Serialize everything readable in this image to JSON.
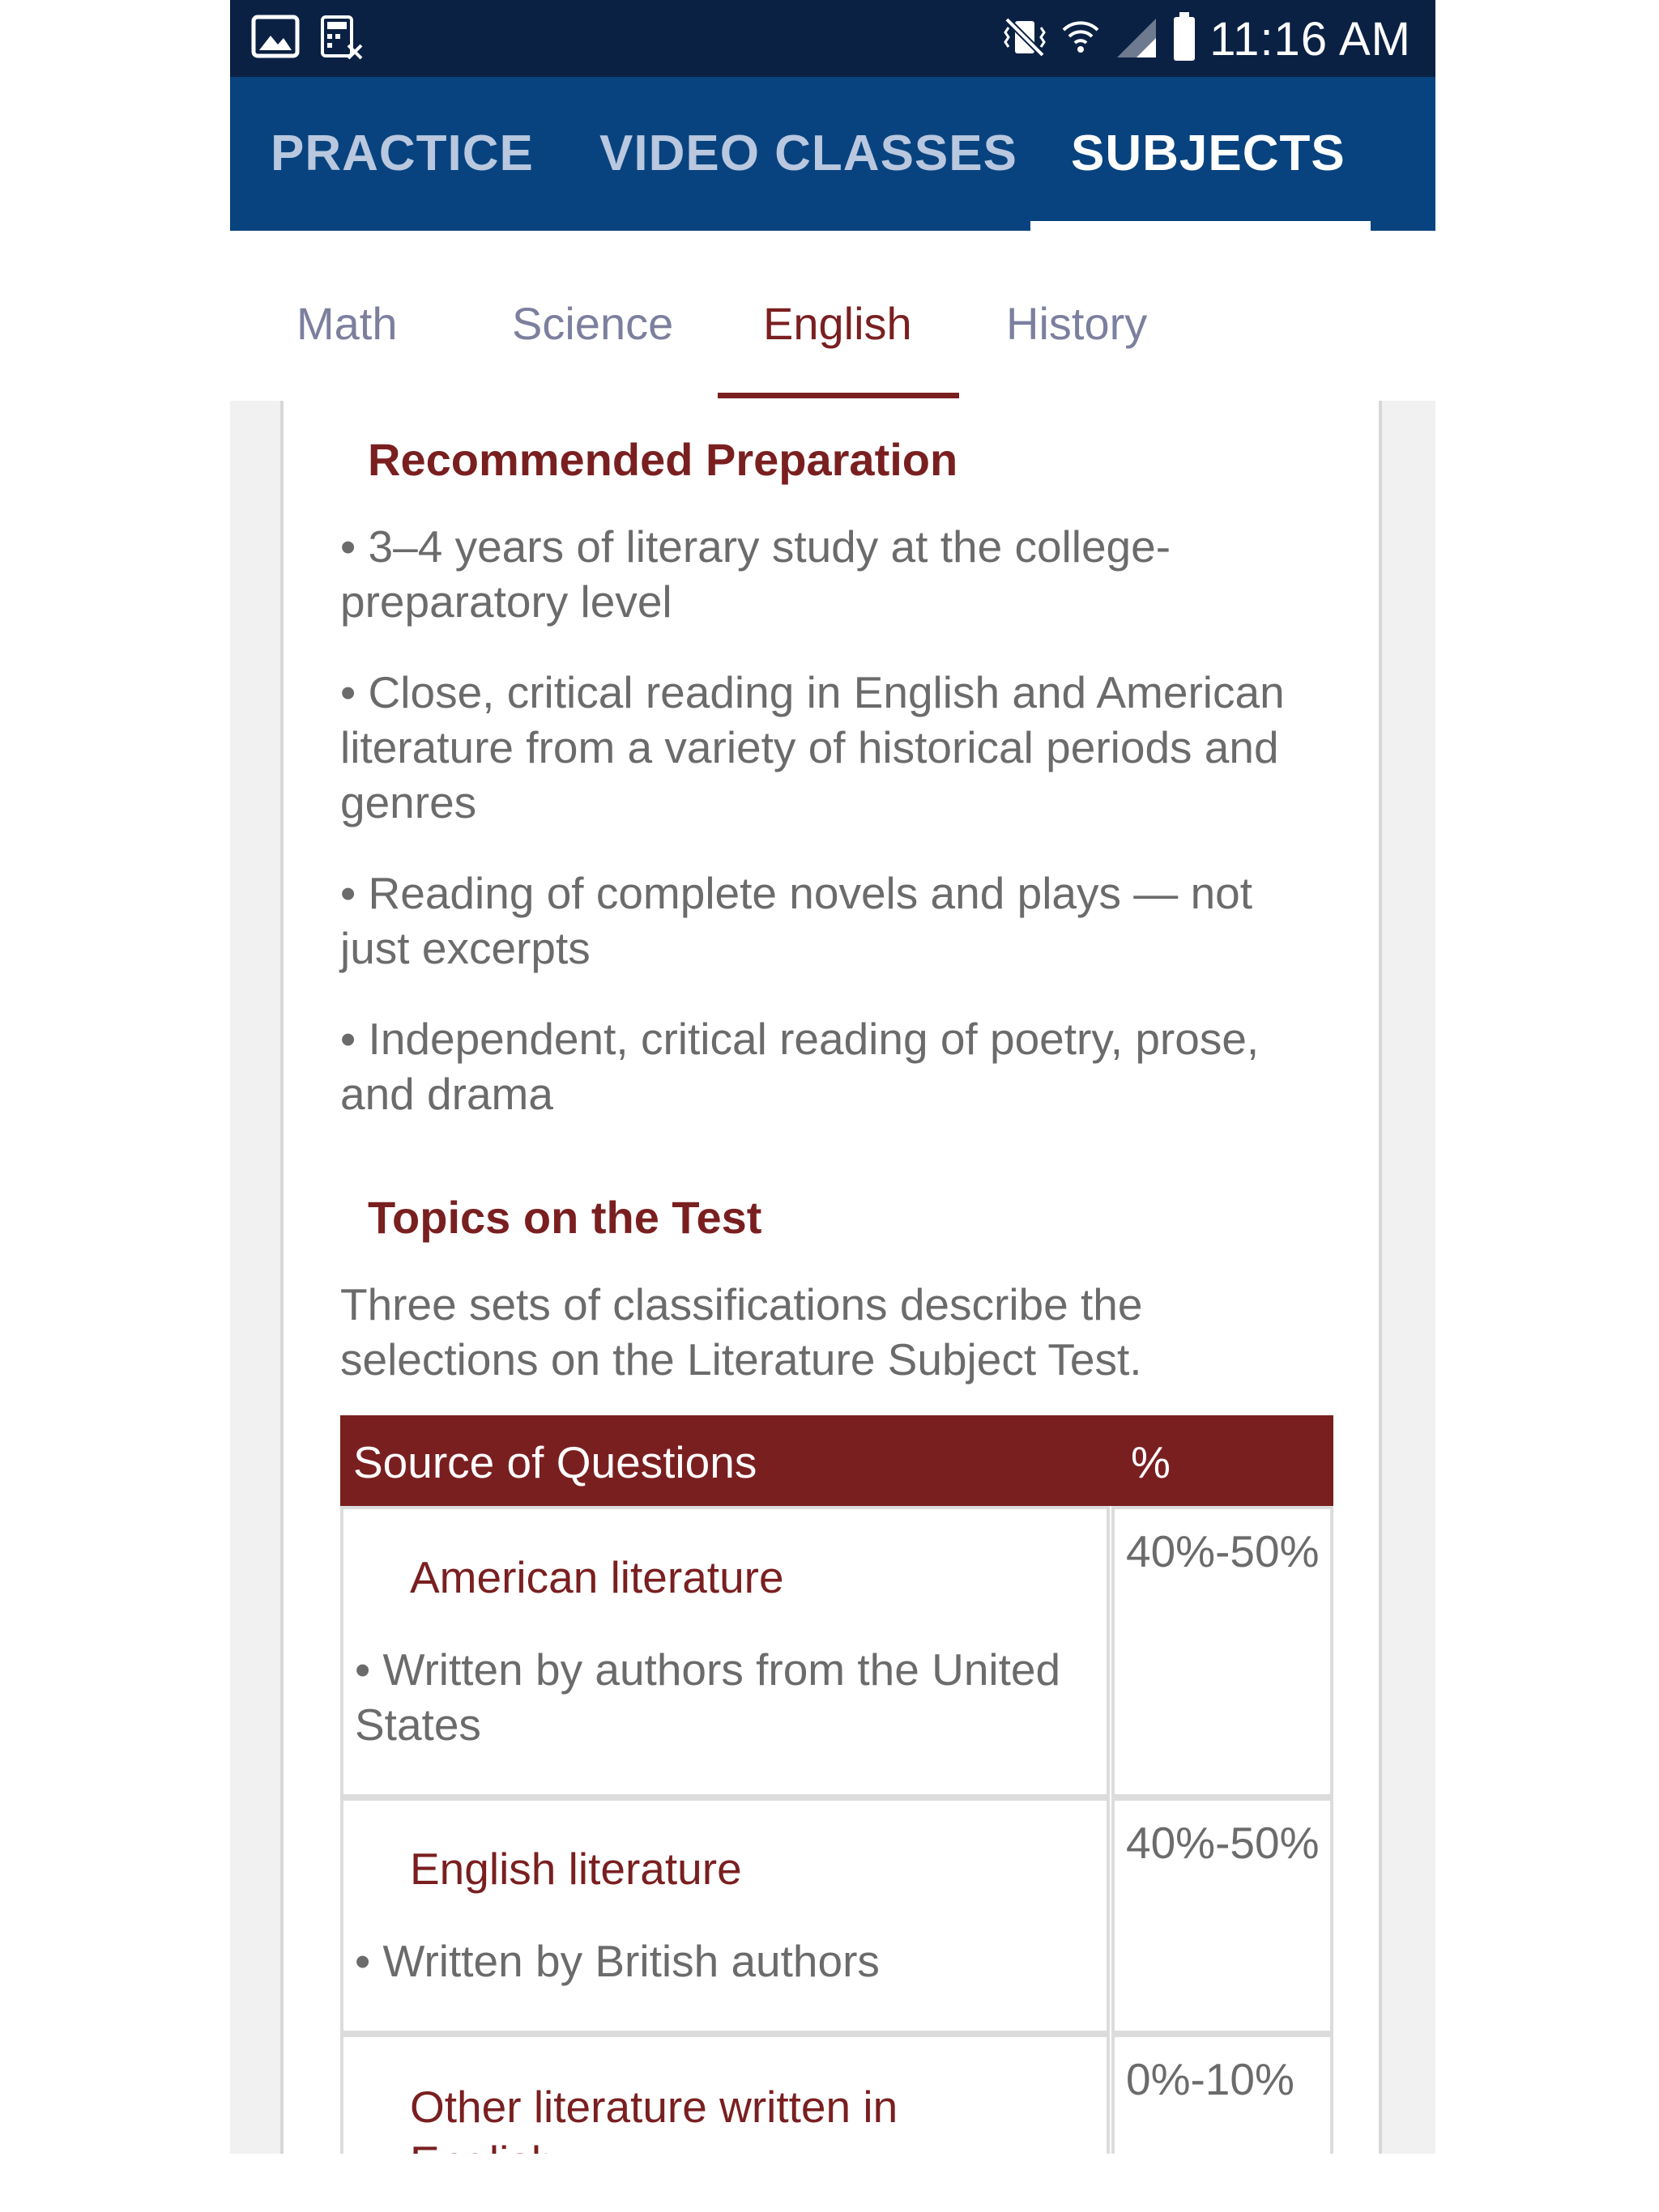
{
  "status_bar": {
    "time": "11:16 AM",
    "icons": [
      "image-icon",
      "calculator-icon",
      "vibrate-icon",
      "wifi-icon",
      "signal-icon",
      "battery-icon"
    ]
  },
  "app_tabs": [
    {
      "label": "PRACTICE",
      "active": false
    },
    {
      "label": "VIDEO CLASSES",
      "active": false
    },
    {
      "label": "SUBJECTS",
      "active": true
    }
  ],
  "subject_tabs": [
    {
      "label": "Math",
      "active": false
    },
    {
      "label": "Science",
      "active": false
    },
    {
      "label": "English",
      "active": true
    },
    {
      "label": "History",
      "active": false
    }
  ],
  "content": {
    "recommended_heading": "Recommended Preparation",
    "recommended_items": [
      "• 3–4 years of literary study at the college-preparatory level",
      "• Close, critical reading in English and American literature from a variety of historical periods and genres",
      "• Reading of complete novels and plays — not just excerpts",
      "• Independent, critical reading of poetry, prose, and drama"
    ],
    "topics_heading": "Topics on the Test",
    "topics_intro": "Three sets of classifications describe the selections on the Literature Subject Test.",
    "table": {
      "col_source": "Source of Questions",
      "col_percent": "%",
      "rows": [
        {
          "name": "American literature",
          "desc": "• Written by authors from the United States",
          "percent": "40%-50%"
        },
        {
          "name": "English literature",
          "desc": "• Written by British authors",
          "percent": "40%-50%"
        },
        {
          "name": "Other literature written in English",
          "desc": "",
          "percent": "0%-10%"
        }
      ]
    }
  },
  "colors": {
    "status_bar": "#0a2144",
    "app_bar": "#08437f",
    "accent_maroon": "#7a1f20",
    "inactive_tab": "#7c7f9e",
    "body_text": "#6b6b6b"
  }
}
